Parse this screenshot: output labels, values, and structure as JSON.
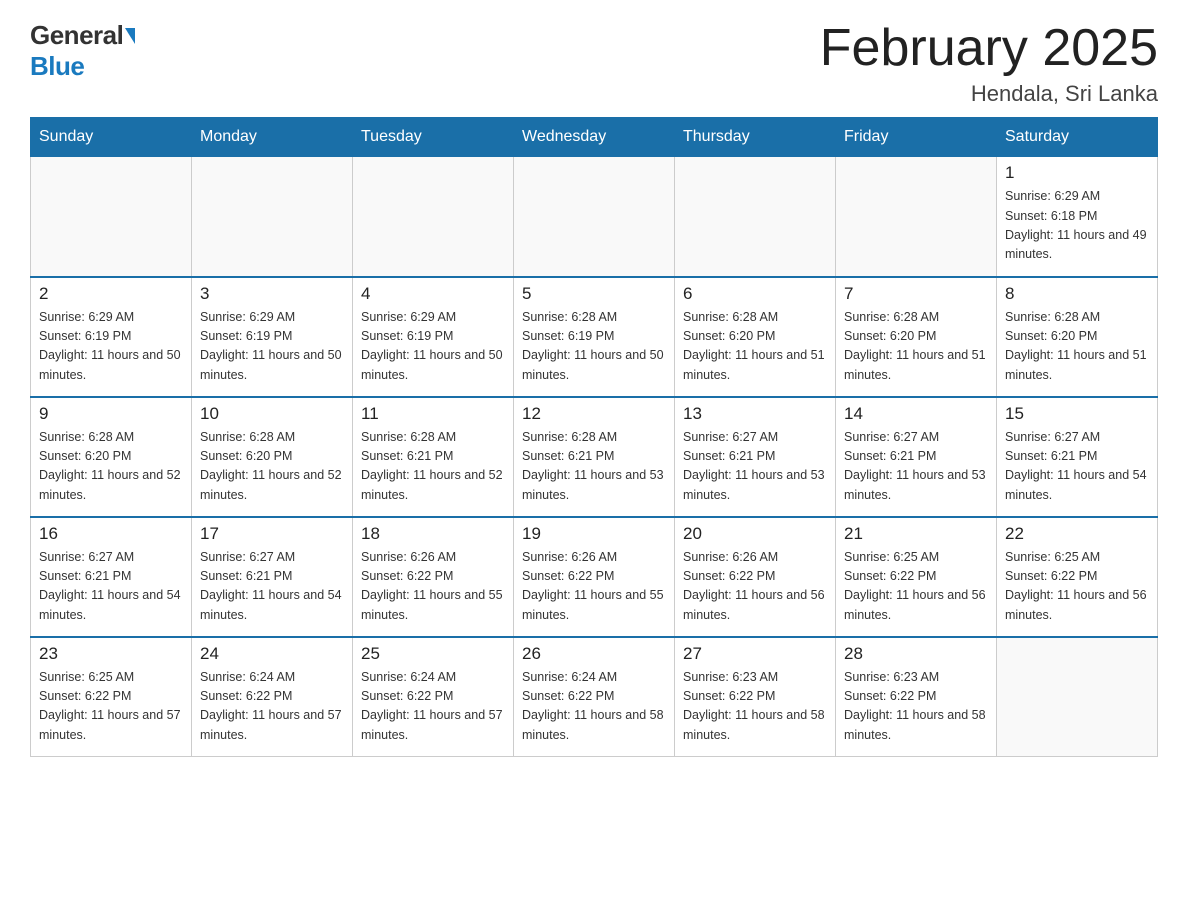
{
  "header": {
    "logo_general": "General",
    "logo_blue": "Blue",
    "month_title": "February 2025",
    "location": "Hendala, Sri Lanka"
  },
  "days_of_week": [
    "Sunday",
    "Monday",
    "Tuesday",
    "Wednesday",
    "Thursday",
    "Friday",
    "Saturday"
  ],
  "weeks": [
    [
      {
        "day": "",
        "sunrise": "",
        "sunset": "",
        "daylight": ""
      },
      {
        "day": "",
        "sunrise": "",
        "sunset": "",
        "daylight": ""
      },
      {
        "day": "",
        "sunrise": "",
        "sunset": "",
        "daylight": ""
      },
      {
        "day": "",
        "sunrise": "",
        "sunset": "",
        "daylight": ""
      },
      {
        "day": "",
        "sunrise": "",
        "sunset": "",
        "daylight": ""
      },
      {
        "day": "",
        "sunrise": "",
        "sunset": "",
        "daylight": ""
      },
      {
        "day": "1",
        "sunrise": "Sunrise: 6:29 AM",
        "sunset": "Sunset: 6:18 PM",
        "daylight": "Daylight: 11 hours and 49 minutes."
      }
    ],
    [
      {
        "day": "2",
        "sunrise": "Sunrise: 6:29 AM",
        "sunset": "Sunset: 6:19 PM",
        "daylight": "Daylight: 11 hours and 50 minutes."
      },
      {
        "day": "3",
        "sunrise": "Sunrise: 6:29 AM",
        "sunset": "Sunset: 6:19 PM",
        "daylight": "Daylight: 11 hours and 50 minutes."
      },
      {
        "day": "4",
        "sunrise": "Sunrise: 6:29 AM",
        "sunset": "Sunset: 6:19 PM",
        "daylight": "Daylight: 11 hours and 50 minutes."
      },
      {
        "day": "5",
        "sunrise": "Sunrise: 6:28 AM",
        "sunset": "Sunset: 6:19 PM",
        "daylight": "Daylight: 11 hours and 50 minutes."
      },
      {
        "day": "6",
        "sunrise": "Sunrise: 6:28 AM",
        "sunset": "Sunset: 6:20 PM",
        "daylight": "Daylight: 11 hours and 51 minutes."
      },
      {
        "day": "7",
        "sunrise": "Sunrise: 6:28 AM",
        "sunset": "Sunset: 6:20 PM",
        "daylight": "Daylight: 11 hours and 51 minutes."
      },
      {
        "day": "8",
        "sunrise": "Sunrise: 6:28 AM",
        "sunset": "Sunset: 6:20 PM",
        "daylight": "Daylight: 11 hours and 51 minutes."
      }
    ],
    [
      {
        "day": "9",
        "sunrise": "Sunrise: 6:28 AM",
        "sunset": "Sunset: 6:20 PM",
        "daylight": "Daylight: 11 hours and 52 minutes."
      },
      {
        "day": "10",
        "sunrise": "Sunrise: 6:28 AM",
        "sunset": "Sunset: 6:20 PM",
        "daylight": "Daylight: 11 hours and 52 minutes."
      },
      {
        "day": "11",
        "sunrise": "Sunrise: 6:28 AM",
        "sunset": "Sunset: 6:21 PM",
        "daylight": "Daylight: 11 hours and 52 minutes."
      },
      {
        "day": "12",
        "sunrise": "Sunrise: 6:28 AM",
        "sunset": "Sunset: 6:21 PM",
        "daylight": "Daylight: 11 hours and 53 minutes."
      },
      {
        "day": "13",
        "sunrise": "Sunrise: 6:27 AM",
        "sunset": "Sunset: 6:21 PM",
        "daylight": "Daylight: 11 hours and 53 minutes."
      },
      {
        "day": "14",
        "sunrise": "Sunrise: 6:27 AM",
        "sunset": "Sunset: 6:21 PM",
        "daylight": "Daylight: 11 hours and 53 minutes."
      },
      {
        "day": "15",
        "sunrise": "Sunrise: 6:27 AM",
        "sunset": "Sunset: 6:21 PM",
        "daylight": "Daylight: 11 hours and 54 minutes."
      }
    ],
    [
      {
        "day": "16",
        "sunrise": "Sunrise: 6:27 AM",
        "sunset": "Sunset: 6:21 PM",
        "daylight": "Daylight: 11 hours and 54 minutes."
      },
      {
        "day": "17",
        "sunrise": "Sunrise: 6:27 AM",
        "sunset": "Sunset: 6:21 PM",
        "daylight": "Daylight: 11 hours and 54 minutes."
      },
      {
        "day": "18",
        "sunrise": "Sunrise: 6:26 AM",
        "sunset": "Sunset: 6:22 PM",
        "daylight": "Daylight: 11 hours and 55 minutes."
      },
      {
        "day": "19",
        "sunrise": "Sunrise: 6:26 AM",
        "sunset": "Sunset: 6:22 PM",
        "daylight": "Daylight: 11 hours and 55 minutes."
      },
      {
        "day": "20",
        "sunrise": "Sunrise: 6:26 AM",
        "sunset": "Sunset: 6:22 PM",
        "daylight": "Daylight: 11 hours and 56 minutes."
      },
      {
        "day": "21",
        "sunrise": "Sunrise: 6:25 AM",
        "sunset": "Sunset: 6:22 PM",
        "daylight": "Daylight: 11 hours and 56 minutes."
      },
      {
        "day": "22",
        "sunrise": "Sunrise: 6:25 AM",
        "sunset": "Sunset: 6:22 PM",
        "daylight": "Daylight: 11 hours and 56 minutes."
      }
    ],
    [
      {
        "day": "23",
        "sunrise": "Sunrise: 6:25 AM",
        "sunset": "Sunset: 6:22 PM",
        "daylight": "Daylight: 11 hours and 57 minutes."
      },
      {
        "day": "24",
        "sunrise": "Sunrise: 6:24 AM",
        "sunset": "Sunset: 6:22 PM",
        "daylight": "Daylight: 11 hours and 57 minutes."
      },
      {
        "day": "25",
        "sunrise": "Sunrise: 6:24 AM",
        "sunset": "Sunset: 6:22 PM",
        "daylight": "Daylight: 11 hours and 57 minutes."
      },
      {
        "day": "26",
        "sunrise": "Sunrise: 6:24 AM",
        "sunset": "Sunset: 6:22 PM",
        "daylight": "Daylight: 11 hours and 58 minutes."
      },
      {
        "day": "27",
        "sunrise": "Sunrise: 6:23 AM",
        "sunset": "Sunset: 6:22 PM",
        "daylight": "Daylight: 11 hours and 58 minutes."
      },
      {
        "day": "28",
        "sunrise": "Sunrise: 6:23 AM",
        "sunset": "Sunset: 6:22 PM",
        "daylight": "Daylight: 11 hours and 58 minutes."
      },
      {
        "day": "",
        "sunrise": "",
        "sunset": "",
        "daylight": ""
      }
    ]
  ]
}
